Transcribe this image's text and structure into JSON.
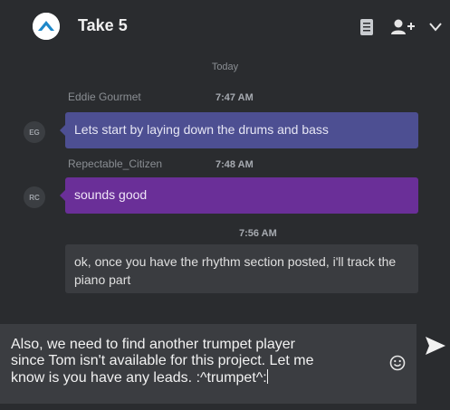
{
  "header": {
    "title": "Take 5",
    "icons": [
      "app-logo-icon",
      "document-icon",
      "add-user-icon",
      "chevron-down-icon"
    ]
  },
  "chat": {
    "day_divider": "Today",
    "messages": [
      {
        "sender": "Eddie Gourmet",
        "initials": "EG",
        "time": "7:47 AM",
        "text": "Lets start by laying down the drums and bass",
        "color": "#4d4f92"
      },
      {
        "sender": "Repectable_Citizen",
        "initials": "RC",
        "time": "7:48 AM",
        "text": "sounds good",
        "color": "#6a2f98"
      },
      {
        "time": "7:56 AM",
        "text": "ok, once you have the rhythm section posted, i'll track the piano part",
        "color": "#3a3c40"
      }
    ]
  },
  "composer": {
    "line1": "Also, we need to find another trumpet player",
    "line2": "since Tom isn't available for this project. Let me",
    "line3": "know is you have any leads.  :^trumpet^:",
    "emoji_icon": "smiley-icon",
    "send_icon": "send-icon"
  }
}
